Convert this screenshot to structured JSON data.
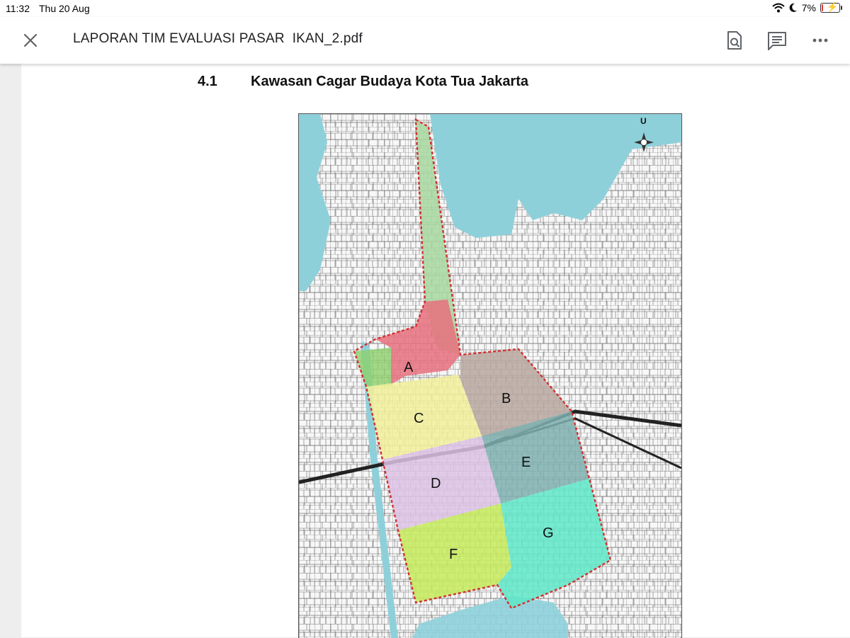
{
  "status_bar": {
    "time": "11:32",
    "date": "Thu 20 Aug",
    "battery_percent": "7%",
    "battery_level": 0.07,
    "battery_color": "#e53935"
  },
  "app_bar": {
    "title": "LAPORAN TIM EVALUASI PASAR  IKAN_2.pdf",
    "icons": [
      "close-icon",
      "search-document-icon",
      "comment-icon",
      "more-options-icon"
    ]
  },
  "document": {
    "section_number": "4.1",
    "section_title": "Kawasan Cagar Budaya Kota Tua Jakarta",
    "map": {
      "north_label": "U",
      "zones": [
        {
          "label": "A",
          "color": "#e8707e"
        },
        {
          "label": "B",
          "color": "#b8a8a0"
        },
        {
          "label": "C",
          "color": "#f2f09a"
        },
        {
          "label": "D",
          "color": "#dcc2e4"
        },
        {
          "label": "E",
          "color": "#7fb0b0"
        },
        {
          "label": "F",
          "color": "#c6ea5a"
        },
        {
          "label": "G",
          "color": "#5ee8c8"
        }
      ],
      "water_color": "#8ed0da",
      "boundary_color": "#d32f2f"
    }
  }
}
